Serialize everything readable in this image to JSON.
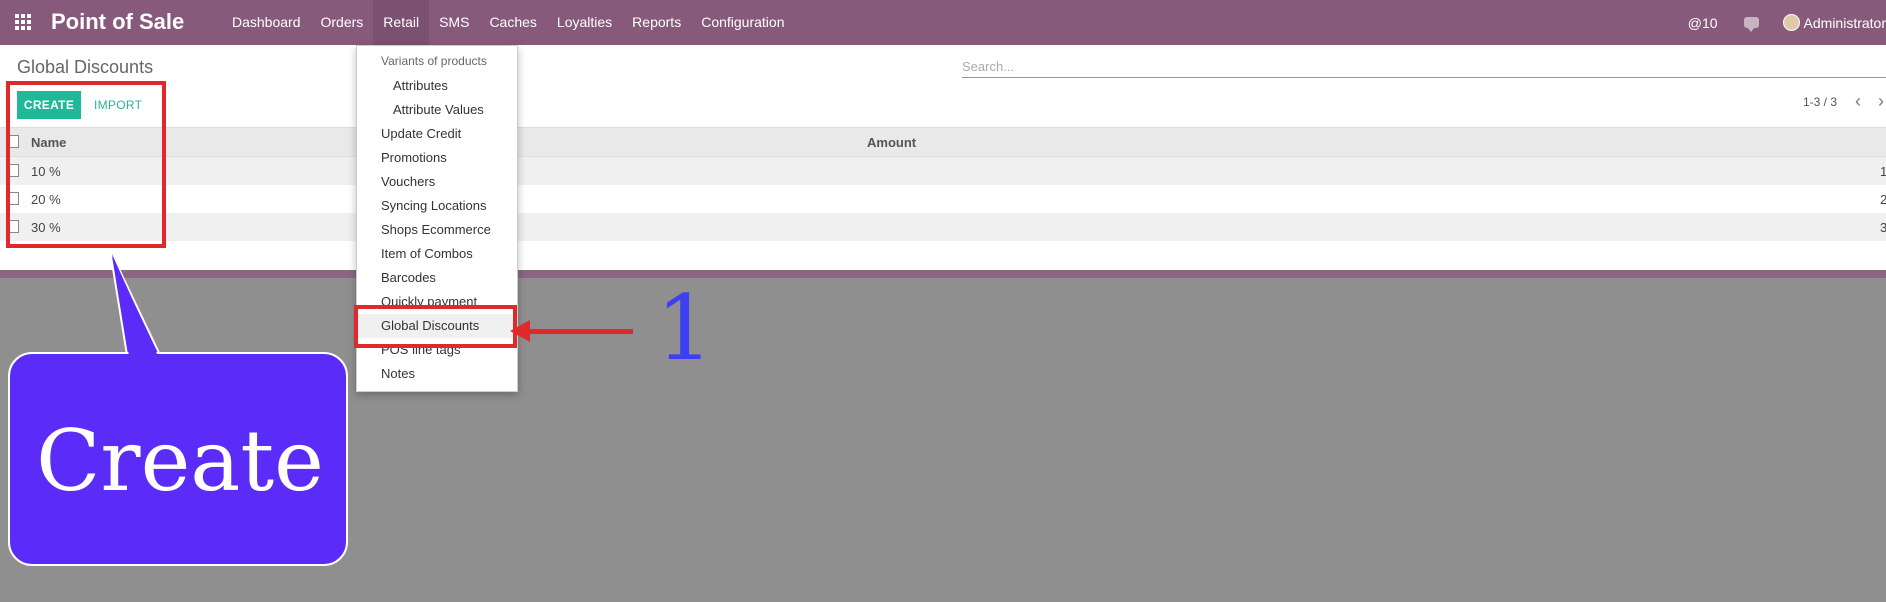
{
  "app": {
    "title": "Point of Sale"
  },
  "menu": [
    "Dashboard",
    "Orders",
    "Retail",
    "SMS",
    "Caches",
    "Loyalties",
    "Reports",
    "Configuration"
  ],
  "topbar": {
    "activity": "@10",
    "user": "Administrator"
  },
  "page": {
    "title": "Global Discounts",
    "create_label": "CREATE",
    "import_label": "IMPORT",
    "search_placeholder": "Search...",
    "pager": "1-3 / 3",
    "pager_prev": "‹",
    "pager_next": "›"
  },
  "table": {
    "columns": [
      "Name",
      "Amount"
    ],
    "rows": [
      {
        "name": "10 %",
        "amount": "1"
      },
      {
        "name": "20 %",
        "amount": "2"
      },
      {
        "name": "30 %",
        "amount": "3"
      }
    ]
  },
  "dropdown": {
    "header": "Variants of products",
    "items": [
      "Attributes",
      "Attribute Values",
      "Update Credit",
      "Promotions",
      "Vouchers",
      "Syncing Locations",
      "Shops Ecommerce",
      "Item of Combos",
      "Barcodes",
      "Quickly payment",
      "Global Discounts",
      "POS line tags",
      "Notes"
    ],
    "selected": "Global Discounts"
  },
  "annotations": {
    "step": "1",
    "callout": "Create"
  },
  "colors": {
    "topbar": "#875a7b",
    "primary": "#21b799",
    "highlight": "#e02a2a",
    "callout": "#5b2cf8",
    "step": "#3e3ff2"
  }
}
